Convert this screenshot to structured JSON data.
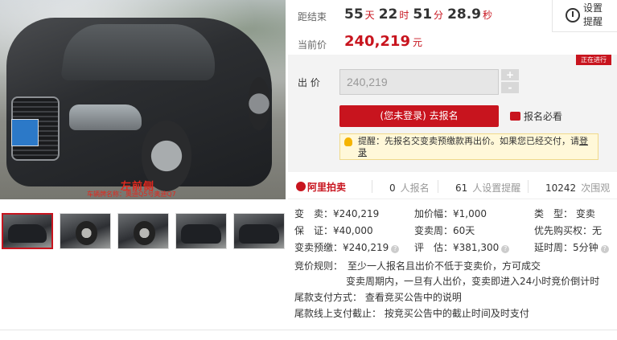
{
  "photo": {
    "watermark_main": "左前侧",
    "watermark_sub": "车辆牌名称：奥迪Q5号奥迪Q7",
    "thumbnails_count": 5,
    "selected_thumbnail": 1
  },
  "auction": {
    "countdown_label": "距结束",
    "countdown": {
      "days": "55",
      "days_unit": "天",
      "hours": "22",
      "hours_unit": "时",
      "minutes": "51",
      "minutes_unit": "分",
      "seconds": "28.9",
      "seconds_unit": "秒"
    },
    "reminder_label": "设置提醒",
    "current_price_label": "当前价",
    "current_price": "240,219",
    "current_price_unit": "元",
    "status_badge": "正在进行",
    "bid_label": "出 价",
    "bid_input_value": "240,219",
    "stepper_plus": "+",
    "stepper_minus": "-",
    "signup_button": "(您未登录) 去报名",
    "must_see_link": "报名必看",
    "tip_text": "提醒：先报名交变卖预缴款再出价。如果您已经交付，请",
    "tip_login": "登录"
  },
  "brand_row": {
    "logo": "阿里拍卖",
    "registered_count": "0",
    "registered_label": "人报名",
    "reminder_count": "61",
    "reminder_label": "人设置提醒",
    "views_count": "10242",
    "views_label": "次围观"
  },
  "details": {
    "sale_price": "变　卖：¥240,219",
    "increment": "加价幅：¥1,000",
    "type": "类　型：  变卖",
    "deposit": "保　证：¥40,000",
    "period": "变卖周：60天",
    "priority": "优先购买权：无",
    "prepay": "变卖预缴：¥240,219",
    "appraisal": "评　估：¥381,300",
    "extension": "延时周：5分钟"
  },
  "rules": {
    "bid_rule_label": "竞价规则：",
    "bid_rule_line1": "至少一人报名且出价不低于变卖价，方可成交",
    "bid_rule_line2": "变卖周期内，一旦有人出价，变卖即进入24小时竞价倒计时",
    "final_payment_method": "尾款支付方式：  查看竞买公告中的说明",
    "final_payment_deadline": "尾款线上支付截止：  按竞买公告中的截止时间及时支付"
  },
  "colors": {
    "accent": "#c8141e",
    "grey_block": "#f3f3f3",
    "tip_background": "#fff8d9"
  }
}
